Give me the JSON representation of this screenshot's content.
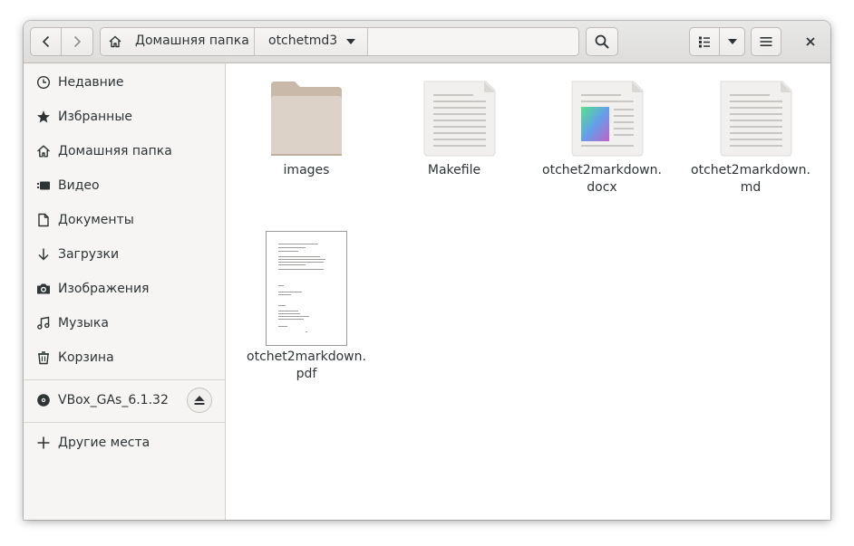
{
  "header": {
    "path": {
      "home_label": "Домашняя папка",
      "current_label": "otchetmd3"
    }
  },
  "sidebar": {
    "items": [
      {
        "label": "Недавние",
        "icon": "clock-icon"
      },
      {
        "label": "Избранные",
        "icon": "star-icon"
      },
      {
        "label": "Домашняя папка",
        "icon": "home-icon"
      },
      {
        "label": "Видео",
        "icon": "video-icon"
      },
      {
        "label": "Документы",
        "icon": "document-icon"
      },
      {
        "label": "Загрузки",
        "icon": "download-icon"
      },
      {
        "label": "Изображения",
        "icon": "camera-icon"
      },
      {
        "label": "Музыка",
        "icon": "music-icon"
      },
      {
        "label": "Корзина",
        "icon": "trash-icon"
      }
    ],
    "device": {
      "label": "VBox_GAs_6.1.32",
      "icon": "disc-icon"
    },
    "other": {
      "label": "Другие места",
      "icon": "plus-icon"
    }
  },
  "files": [
    {
      "name_line1": "images",
      "name_line2": "",
      "icon": "folder-icon"
    },
    {
      "name_line1": "Makefile",
      "name_line2": "",
      "icon": "text-file-icon"
    },
    {
      "name_line1": "otchet2markdown.",
      "name_line2": "docx",
      "icon": "docx-file-icon"
    },
    {
      "name_line1": "otchet2markdown.",
      "name_line2": "md",
      "icon": "text-file-icon"
    },
    {
      "name_line1": "otchet2markdown.",
      "name_line2": "pdf",
      "icon": "pdf-thumbnail-icon"
    }
  ],
  "colors": {
    "folder": "#d9cfc4",
    "folder_tab": "#c9b9a8",
    "sidebar_bg": "#f6f5f4",
    "headerbar_bg": "#e2e1df"
  }
}
